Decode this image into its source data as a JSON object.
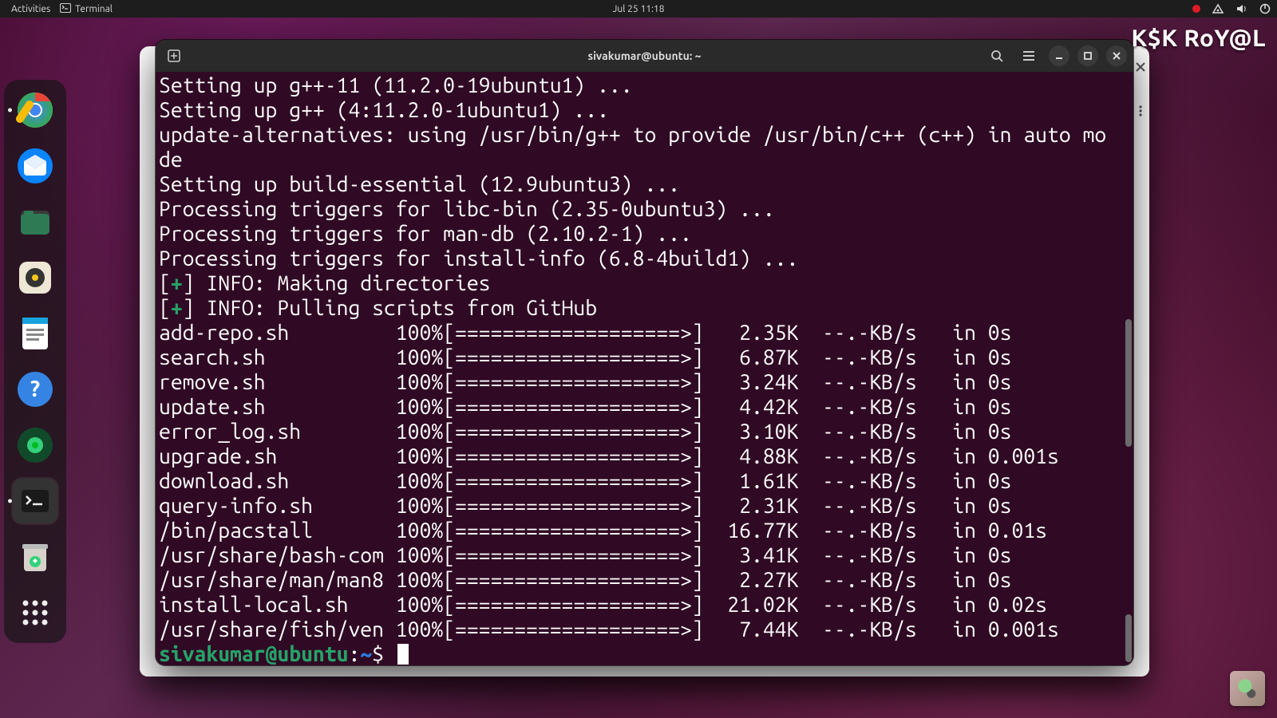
{
  "topbar": {
    "activities": "Activities",
    "app_label": "Terminal",
    "clock": "Jul 25  11:18"
  },
  "watermark": "K$K RoY@L",
  "terminal": {
    "title": "sivakumar@ubuntu: ~",
    "prompt_user": "sivakumar@ubuntu",
    "prompt_sep": ":",
    "prompt_path": "~",
    "prompt_symbol": "$",
    "setup_lines": [
      "Setting up g++-11 (11.2.0-19ubuntu1) ...",
      "Setting up g++ (4:11.2.0-1ubuntu1) ...",
      "update-alternatives: using /usr/bin/g++ to provide /usr/bin/c++ (c++) in auto mo",
      "de",
      "Setting up build-essential (12.9ubuntu3) ...",
      "Processing triggers for libc-bin (2.35-0ubuntu3) ...",
      "Processing triggers for man-db (2.10.2-1) ...",
      "Processing triggers for install-info (6.8-4build1) ..."
    ],
    "info_lines": [
      "INFO: Making directories",
      "INFO: Pulling scripts from GitHub"
    ],
    "progress_bar": "[===================>]",
    "downloads": [
      {
        "name": "add-repo.sh",
        "pct": "100%",
        "size": "2.35K",
        "speed": "--.-KB/s",
        "in": "in 0s"
      },
      {
        "name": "search.sh",
        "pct": "100%",
        "size": "6.87K",
        "speed": "--.-KB/s",
        "in": "in 0s"
      },
      {
        "name": "remove.sh",
        "pct": "100%",
        "size": "3.24K",
        "speed": "--.-KB/s",
        "in": "in 0s"
      },
      {
        "name": "update.sh",
        "pct": "100%",
        "size": "4.42K",
        "speed": "--.-KB/s",
        "in": "in 0s"
      },
      {
        "name": "error_log.sh",
        "pct": "100%",
        "size": "3.10K",
        "speed": "--.-KB/s",
        "in": "in 0s"
      },
      {
        "name": "upgrade.sh",
        "pct": "100%",
        "size": "4.88K",
        "speed": "--.-KB/s",
        "in": "in 0.001s"
      },
      {
        "name": "download.sh",
        "pct": "100%",
        "size": "1.61K",
        "speed": "--.-KB/s",
        "in": "in 0s"
      },
      {
        "name": "query-info.sh",
        "pct": "100%",
        "size": "2.31K",
        "speed": "--.-KB/s",
        "in": "in 0s"
      },
      {
        "name": "/bin/pacstall",
        "pct": "100%",
        "size": "16.77K",
        "speed": "--.-KB/s",
        "in": "in 0.01s"
      },
      {
        "name": "/usr/share/bash-com",
        "pct": "100%",
        "size": "3.41K",
        "speed": "--.-KB/s",
        "in": "in 0s"
      },
      {
        "name": "/usr/share/man/man8",
        "pct": "100%",
        "size": "2.27K",
        "speed": "--.-KB/s",
        "in": "in 0s"
      },
      {
        "name": "install-local.sh",
        "pct": "100%",
        "size": "21.02K",
        "speed": "--.-KB/s",
        "in": "in 0.02s"
      },
      {
        "name": "/usr/share/fish/ven",
        "pct": "100%",
        "size": "7.44K",
        "speed": "--.-KB/s",
        "in": "in 0.001s"
      }
    ]
  },
  "dock": {
    "items": [
      "chrome",
      "thunderbird",
      "files",
      "rhythmbox",
      "writer",
      "help",
      "dummy",
      "terminal",
      "trash",
      "apps"
    ]
  }
}
